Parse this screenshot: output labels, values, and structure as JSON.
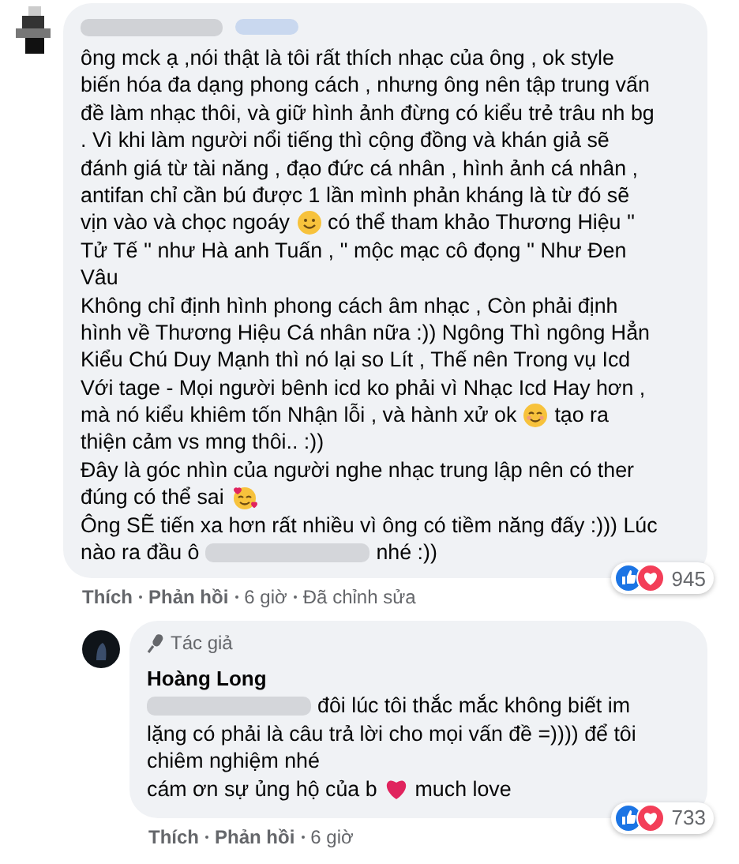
{
  "comments": [
    {
      "body": [
        [
          {
            "kind": "text",
            "text": "ông mck ạ ,nói thật là tôi rất thích nhạc của ông , ok style"
          }
        ],
        [
          {
            "kind": "text",
            "text": "biến hóa đa dạng phong cách , nhưng ông nên tập trung vấn"
          }
        ],
        [
          {
            "kind": "text",
            "text": "đề làm nhạc thôi, và giữ hình ảnh đừng có kiểu trẻ trâu nh bg"
          }
        ],
        [
          {
            "kind": "text",
            "text": ". Vì khi làm người nổi tiếng thì cộng đồng và khán giả sẽ"
          }
        ],
        [
          {
            "kind": "text",
            "text": "đánh giá từ tài năng , đạo đức cá nhân , hình ảnh cá nhân ,"
          }
        ],
        [
          {
            "kind": "text",
            "text": "antifan chỉ cần bú được 1 lần mình phản kháng là từ đó sẽ"
          }
        ],
        [
          {
            "kind": "text",
            "text": "vịn vào và chọc ngoáy"
          },
          {
            "kind": "smile"
          },
          {
            "kind": "text",
            "text": "có thể tham khảo Thương Hiệu ''"
          }
        ],
        [
          {
            "kind": "text",
            "text": "Tử Tế '' như Hà anh Tuấn , '' mộc mạc cô đọng '' Như Đen"
          }
        ],
        [
          {
            "kind": "text",
            "text": "Vâu"
          }
        ],
        [
          {
            "kind": "text",
            "text": "Không chỉ định hình phong cách âm nhạc , Còn phải định"
          }
        ],
        [
          {
            "kind": "text",
            "text": "hình về Thương Hiệu Cá nhân nữa :)) Ngông Thì ngông Hẳn"
          }
        ],
        [
          {
            "kind": "text",
            "text": "Kiểu Chú Duy Mạnh thì nó lại so Lít , Thế nên Trong vụ Icd"
          }
        ],
        [
          {
            "kind": "text",
            "text": "Với tage - Mọi người bênh icd ko phải vì Nhạc Icd Hay hơn ,"
          }
        ],
        [
          {
            "kind": "text",
            "text": "mà nó kiểu khiêm tốn Nhận lỗi , và hành xử ok"
          },
          {
            "kind": "blush"
          },
          {
            "kind": "text",
            "text": "tạo ra"
          }
        ],
        [
          {
            "kind": "text",
            "text": "thiện cảm vs mng thôi.. :))"
          }
        ],
        [
          {
            "kind": "text",
            "text": "Đây là góc nhìn của người nghe nhạc trung lập nên có ther"
          }
        ],
        [
          {
            "kind": "text",
            "text": "đúng có thể sai"
          },
          {
            "kind": "hearts"
          }
        ],
        [
          {
            "kind": "text",
            "text": "Ông SẼ tiến xa hơn rất nhiều vì ông có tiềm năng đấy :))) Lúc"
          }
        ],
        [
          {
            "kind": "text",
            "text": "nào ra đầu ô"
          },
          {
            "kind": "redacted"
          },
          {
            "kind": "text",
            "text": "nhé :))"
          }
        ]
      ],
      "reaction_count": "945",
      "actions": [
        {
          "kind": "link",
          "label": "Thích"
        },
        {
          "kind": "link",
          "label": "Phản hồi"
        },
        {
          "kind": "meta",
          "label": "6 giờ"
        },
        {
          "kind": "meta",
          "label": "Đã chỉnh sửa"
        }
      ],
      "replies": [
        {
          "author_badge": "Tác giả",
          "author": "Hoàng Long",
          "body": [
            [
              {
                "kind": "redacted"
              },
              {
                "kind": "text",
                "text": "đôi lúc tôi thắc mắc không biết im"
              }
            ],
            [
              {
                "kind": "text",
                "text": "lặng có phải là câu trả lời cho mọi vấn đề =)))) để tôi"
              }
            ],
            [
              {
                "kind": "text",
                "text": "chiêm nghiệm nhé"
              }
            ],
            [
              {
                "kind": "text",
                "text": "cám ơn sự ủng hộ của b"
              },
              {
                "kind": "heart"
              },
              {
                "kind": "text",
                "text": "much love"
              }
            ]
          ],
          "reaction_count": "733",
          "actions": [
            {
              "kind": "link",
              "label": "Thích"
            },
            {
              "kind": "link",
              "label": "Phản hồi"
            },
            {
              "kind": "meta",
              "label": "6 giờ"
            }
          ]
        }
      ]
    }
  ]
}
